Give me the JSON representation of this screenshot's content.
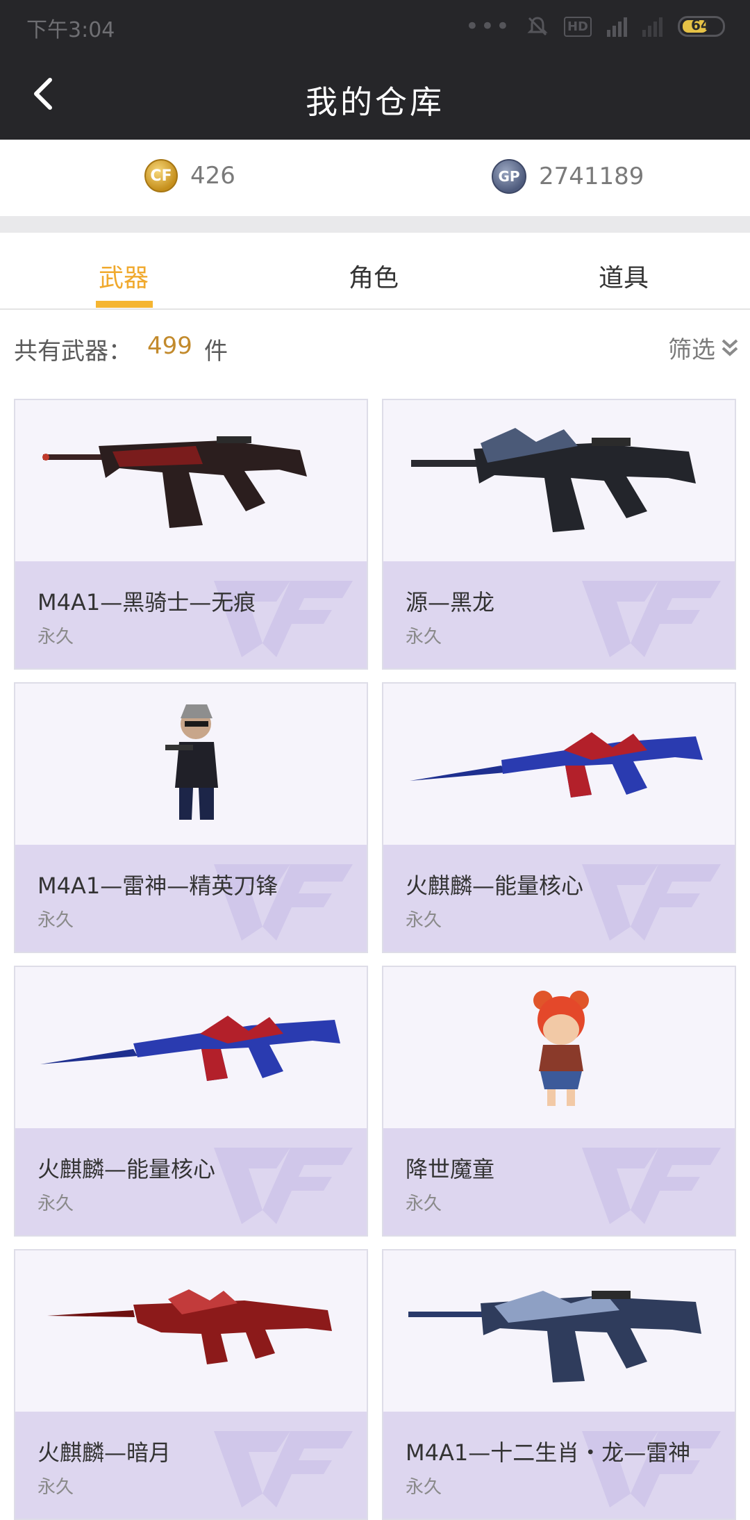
{
  "status": {
    "time": "下午3:04",
    "battery": "64",
    "hd": "HD"
  },
  "header": {
    "title": "我的仓库"
  },
  "currency": {
    "cf_points": "426",
    "gp": "2741189",
    "cf_icon_text": "CF",
    "gp_icon_text": "GP"
  },
  "tabs": [
    {
      "label": "武器",
      "active": true
    },
    {
      "label": "角色",
      "active": false
    },
    {
      "label": "道具",
      "active": false
    }
  ],
  "summary": {
    "label": "共有武器：",
    "count": "499",
    "unit": "件",
    "filter_label": "筛选"
  },
  "items": [
    {
      "name": "M4A1—黑骑士—无痕",
      "duration": "永久",
      "image": "rifle-m4-dark"
    },
    {
      "name": "源—黑龙",
      "duration": "永久",
      "image": "rifle-m4-dragon"
    },
    {
      "name": "M4A1—雷神—精英刀锋",
      "duration": "永久",
      "image": "character-agent"
    },
    {
      "name": "火麒麟—能量核心",
      "duration": "永久",
      "image": "rifle-ak-blue-red"
    },
    {
      "name": "火麒麟—能量核心",
      "duration": "永久",
      "image": "rifle-ak-blue-red"
    },
    {
      "name": "降世魔童",
      "duration": "永久",
      "image": "character-nezha"
    },
    {
      "name": "火麒麟—暗月",
      "duration": "永久",
      "image": "rifle-ak-red"
    },
    {
      "name": "M4A1—十二生肖・龙—雷神",
      "duration": "永久",
      "image": "rifle-m4-zodiac"
    }
  ]
}
